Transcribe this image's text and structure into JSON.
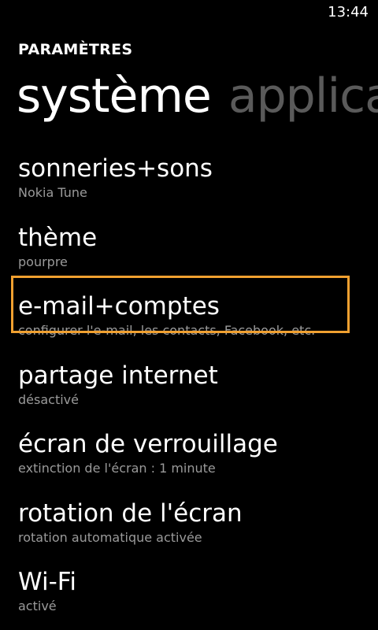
{
  "status_bar": {
    "time": "13:44"
  },
  "header": {
    "app_title": "PARAMÈTRES"
  },
  "pivot": {
    "tabs": [
      {
        "label": "système",
        "active": true
      },
      {
        "label": "applications",
        "active": false
      }
    ]
  },
  "colors": {
    "background": "#000000",
    "text": "#ffffff",
    "subtitle": "#9a9a9a",
    "inactive_pivot": "#5a5a5a",
    "focus_border": "#f0a030"
  },
  "settings": {
    "items": [
      {
        "title": "sonneries+sons",
        "subtitle": "Nokia Tune"
      },
      {
        "title": "thème",
        "subtitle": "pourpre"
      },
      {
        "title": "e-mail+comptes",
        "subtitle": "configurer l'e-mail, les contacts, Facebook, etc.",
        "focused": true
      },
      {
        "title": "partage internet",
        "subtitle": "désactivé"
      },
      {
        "title": "écran de verrouillage",
        "subtitle": "extinction de l'écran : 1 minute"
      },
      {
        "title": "rotation de l'écran",
        "subtitle": "rotation automatique activée"
      },
      {
        "title": "Wi-Fi",
        "subtitle": "activé"
      }
    ]
  }
}
